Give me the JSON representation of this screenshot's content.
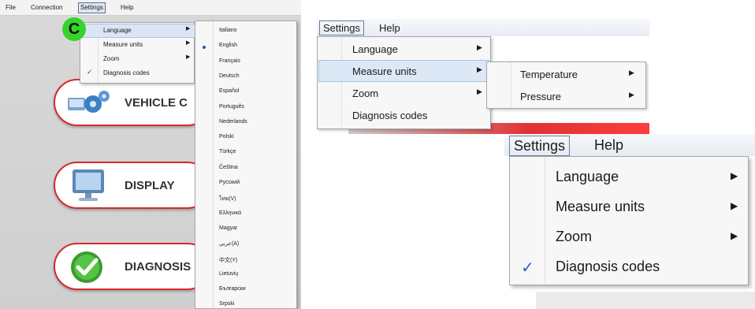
{
  "colors": {
    "accent_red": "#d52a2a",
    "badge_green": "#35d32b",
    "highlight": "#dde8f6",
    "check_blue": "#2a5cc6"
  },
  "panel1": {
    "menubar": [
      "File",
      "Connection",
      "Settings",
      "Help"
    ],
    "badge": "C",
    "settings_menu": [
      {
        "label": "Language",
        "submenu": true,
        "checked": false
      },
      {
        "label": "Measure units",
        "submenu": true,
        "checked": false
      },
      {
        "label": "Zoom",
        "submenu": true,
        "checked": false
      },
      {
        "label": "Diagnosis codes",
        "submenu": false,
        "checked": true
      }
    ],
    "languages": [
      "Italiano",
      "English",
      "Français",
      "Deutsch",
      "Español",
      "Português",
      "Nederlands",
      "Polski",
      "Türkçe",
      "Čeština",
      "Русский",
      "ไทย(V)",
      "Ελληνικά",
      "Magyar",
      "عربي(A)",
      "中文(Y)",
      "Lietuvių",
      "Български",
      "Srpski"
    ],
    "selected_language": "English",
    "buttons": [
      {
        "label": "VEHICLE C",
        "icon": "gears-icon"
      },
      {
        "label": "DISPLAY",
        "icon": "monitor-icon"
      },
      {
        "label": "DIAGNOSIS",
        "icon": "checkmark-icon"
      }
    ]
  },
  "panel2": {
    "menubar": {
      "settings": "Settings",
      "help": "Help"
    },
    "settings_menu": [
      "Language",
      "Measure units",
      "Zoom",
      "Diagnosis codes"
    ],
    "measure_submenu": [
      "Temperature",
      "Pressure"
    ]
  },
  "panel3": {
    "menubar": {
      "settings": "Settings",
      "help": "Help"
    },
    "settings_menu": [
      "Language",
      "Measure units",
      "Zoom",
      "Diagnosis codes"
    ],
    "check_mark": "✓",
    "submenu_arrow": "▶"
  }
}
